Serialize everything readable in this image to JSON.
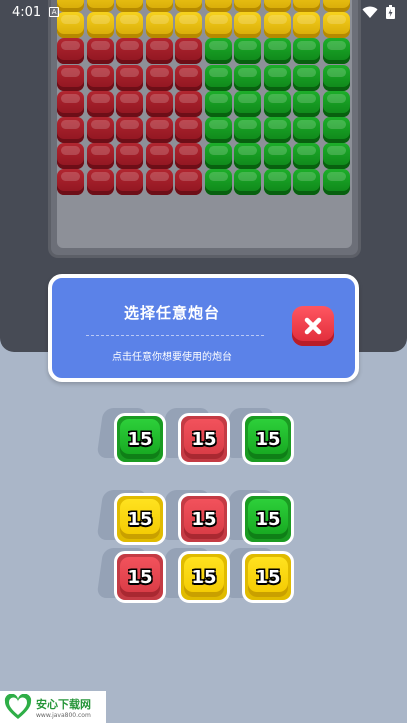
{
  "status_bar": {
    "time": "4:01",
    "icons": [
      "notification-a-icon",
      "wifi-icon",
      "battery-icon"
    ]
  },
  "board": {
    "columns": 10,
    "rows": 8,
    "grid": [
      [
        "yellow",
        "yellow",
        "yellow",
        "yellow",
        "yellow",
        "yellow",
        "yellow",
        "yellow",
        "yellow",
        "yellow"
      ],
      [
        "yellow",
        "yellow",
        "yellow",
        "yellow",
        "yellow",
        "yellow",
        "yellow",
        "yellow",
        "yellow",
        "yellow"
      ],
      [
        "red",
        "red",
        "red",
        "red",
        "red",
        "green",
        "green",
        "green",
        "green",
        "green"
      ],
      [
        "red",
        "red",
        "red",
        "red",
        "red",
        "green",
        "green",
        "green",
        "green",
        "green"
      ],
      [
        "red",
        "red",
        "red",
        "red",
        "red",
        "green",
        "green",
        "green",
        "green",
        "green"
      ],
      [
        "red",
        "red",
        "red",
        "red",
        "red",
        "green",
        "green",
        "green",
        "green",
        "green"
      ],
      [
        "red",
        "red",
        "red",
        "red",
        "red",
        "green",
        "green",
        "green",
        "green",
        "green"
      ],
      [
        "red",
        "red",
        "red",
        "red",
        "red",
        "green",
        "green",
        "green",
        "green",
        "green"
      ]
    ]
  },
  "dialog": {
    "title": "选择任意炮台",
    "subtitle": "点击任意你想要使用的炮台",
    "close_icon": "close-x-icon"
  },
  "turrets": [
    {
      "color": "green",
      "value": "15"
    },
    {
      "color": "red",
      "value": "15"
    },
    {
      "color": "green",
      "value": "15"
    },
    {
      "color": "yellow",
      "value": "15"
    },
    {
      "color": "red",
      "value": "15"
    },
    {
      "color": "green",
      "value": "15"
    },
    {
      "color": "red",
      "value": "15"
    },
    {
      "color": "yellow",
      "value": "15"
    },
    {
      "color": "yellow",
      "value": "15"
    }
  ],
  "watermark": {
    "name": "安心下载网",
    "url": "www.java800.com"
  },
  "colors": {
    "background": "#aab6c8",
    "panel": "#474b55",
    "dialog": "#5b82e8",
    "close_button": "#ee3d49",
    "yellow": "#f0c812",
    "red": "#a11d27",
    "green": "#15991f"
  }
}
